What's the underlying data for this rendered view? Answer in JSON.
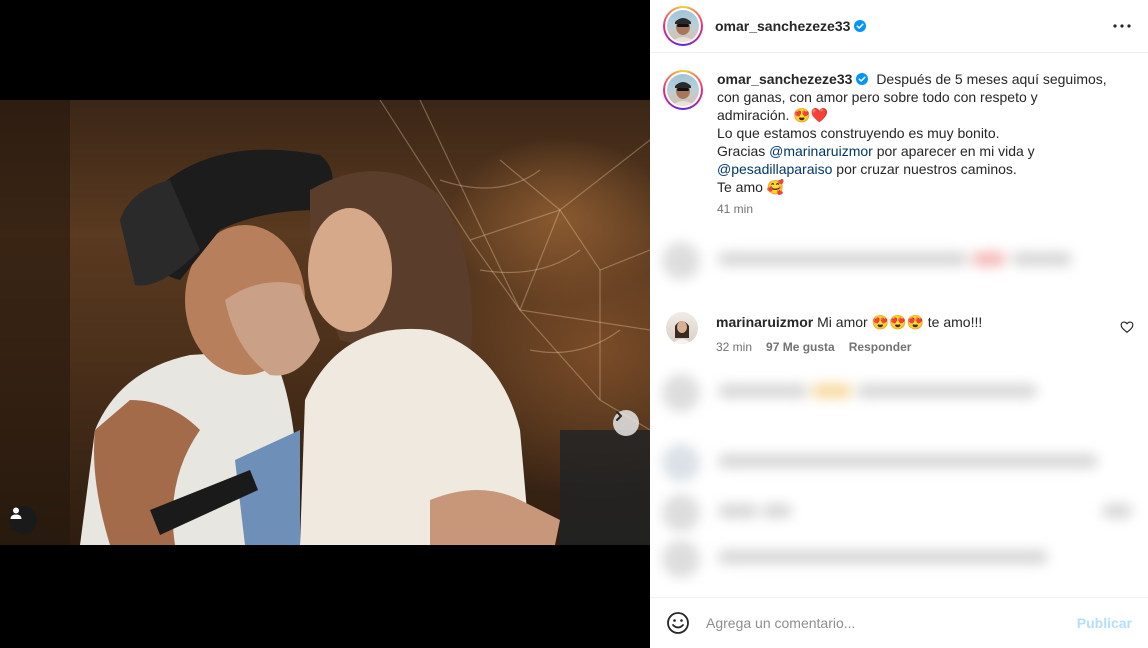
{
  "post": {
    "username": "omar_sanchezeze33",
    "caption_lines": [
      "Después de 5 meses aquí seguimos,",
      "con ganas, con amor pero sobre todo con respeto y",
      "admiración."
    ],
    "caption_emoji_1": "😍❤️",
    "line_4": "Lo que estamos construyendo es muy bonito.",
    "line_5_prefix": "Gracias",
    "mention_1": "@marinaruizmor",
    "line_5_suffix": "por aparecer en mi vida y",
    "mention_2": "@pesadillaparaiso",
    "line_6_suffix": "por cruzar nuestros caminos.",
    "line_7": "Te amo 🥰",
    "time": "41 min"
  },
  "header": {
    "username": "omar_sanchezeze33"
  },
  "comment": {
    "username": "marinaruizmor",
    "text": "Mi amor 😍😍😍 te amo!!!",
    "time": "32 min",
    "likes": "97 Me gusta",
    "reply": "Responder"
  },
  "footer": {
    "placeholder": "Agrega un comentario...",
    "publish": "Publicar"
  },
  "colors": {
    "verified": "#0095f6",
    "mention": "#00376b",
    "publish_disabled": "#b2dffc"
  },
  "icons": {
    "next": "chevron-right-icon",
    "tag": "user-tag-icon",
    "more": "more-horizontal-icon",
    "verified": "verified-badge-icon",
    "heart": "heart-outline-icon",
    "emoji": "emoji-icon"
  }
}
